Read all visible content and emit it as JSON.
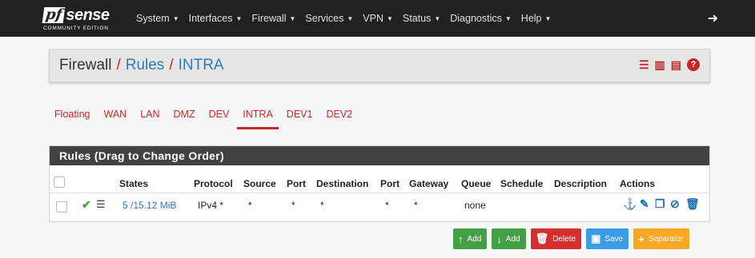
{
  "navbar": {
    "brand_pf": "pf",
    "brand_sense": "sense",
    "brand_edition": "COMMUNITY EDITION",
    "menu": [
      "System",
      "Interfaces",
      "Firewall",
      "Services",
      "VPN",
      "Status",
      "Diagnostics",
      "Help"
    ],
    "logout_icon": "sign-out-icon"
  },
  "breadcrumb": {
    "part1": "Firewall",
    "part2": "Rules",
    "part3": "INTRA",
    "sep": "/"
  },
  "header_icons": [
    "sliders-icon",
    "bar-chart-icon",
    "list-icon",
    "help-icon"
  ],
  "tabs": [
    "Floating",
    "WAN",
    "LAN",
    "DMZ",
    "DEV",
    "INTRA",
    "DEV1",
    "DEV2"
  ],
  "active_tab": "INTRA",
  "rules": {
    "title": "Rules (Drag to Change Order)",
    "columns": [
      "States",
      "Protocol",
      "Source",
      "Port",
      "Destination",
      "Port",
      "Gateway",
      "Queue",
      "Schedule",
      "Description",
      "Actions"
    ],
    "row": {
      "states": "5 /15.12 MiB",
      "protocol": "IPv4 *",
      "source": "*",
      "source_port": "*",
      "destination": "*",
      "dest_port": "*",
      "gateway": "*",
      "queue": "none",
      "schedule": "",
      "description": ""
    }
  },
  "buttons": {
    "add_top": "Add",
    "add_bottom": "Add",
    "delete": "Delete",
    "save": "Save",
    "separator": "Separator"
  },
  "colors": {
    "accent": "#c62828",
    "link": "#2e7abf",
    "navbar": "#212121"
  }
}
